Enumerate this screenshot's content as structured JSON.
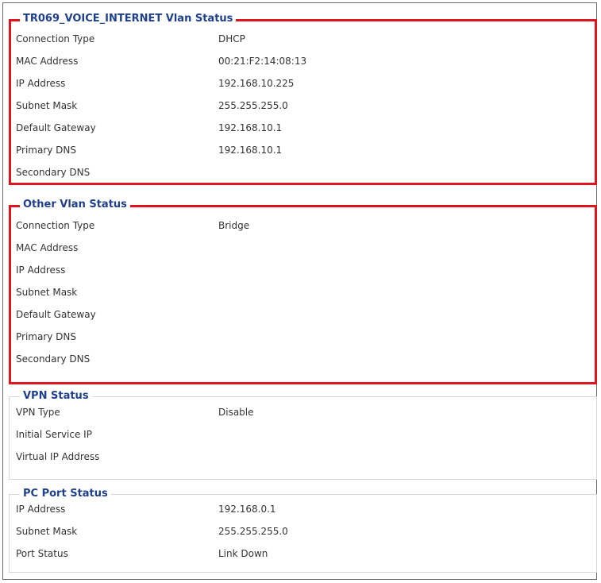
{
  "sections": [
    {
      "title": "TR069_VOICE_INTERNET Vlan Status",
      "rows": [
        {
          "label": "Connection Type",
          "value": "DHCP"
        },
        {
          "label": "MAC Address",
          "value": "00:21:F2:14:08:13"
        },
        {
          "label": "IP Address",
          "value": "192.168.10.225"
        },
        {
          "label": "Subnet Mask",
          "value": "255.255.255.0"
        },
        {
          "label": "Default Gateway",
          "value": "192.168.10.1"
        },
        {
          "label": "Primary DNS",
          "value": "192.168.10.1"
        },
        {
          "label": "Secondary DNS",
          "value": ""
        }
      ]
    },
    {
      "title": "Other Vlan Status",
      "rows": [
        {
          "label": "Connection Type",
          "value": "Bridge"
        },
        {
          "label": "MAC Address",
          "value": ""
        },
        {
          "label": "IP Address",
          "value": ""
        },
        {
          "label": "Subnet Mask",
          "value": ""
        },
        {
          "label": "Default Gateway",
          "value": ""
        },
        {
          "label": "Primary DNS",
          "value": ""
        },
        {
          "label": "Secondary DNS",
          "value": ""
        }
      ]
    },
    {
      "title": "VPN Status",
      "rows": [
        {
          "label": "VPN Type",
          "value": "Disable"
        },
        {
          "label": "Initial Service IP",
          "value": ""
        },
        {
          "label": "Virtual IP Address",
          "value": ""
        }
      ]
    },
    {
      "title": "PC Port Status",
      "rows": [
        {
          "label": "IP Address",
          "value": "192.168.0.1"
        },
        {
          "label": "Subnet Mask",
          "value": "255.255.255.0"
        },
        {
          "label": "Port Status",
          "value": "Link Down"
        }
      ]
    }
  ],
  "colors": {
    "highlight": "#e0141c",
    "legend_text": "#1f3f8f",
    "fieldset_border": "#d6d6d6"
  }
}
